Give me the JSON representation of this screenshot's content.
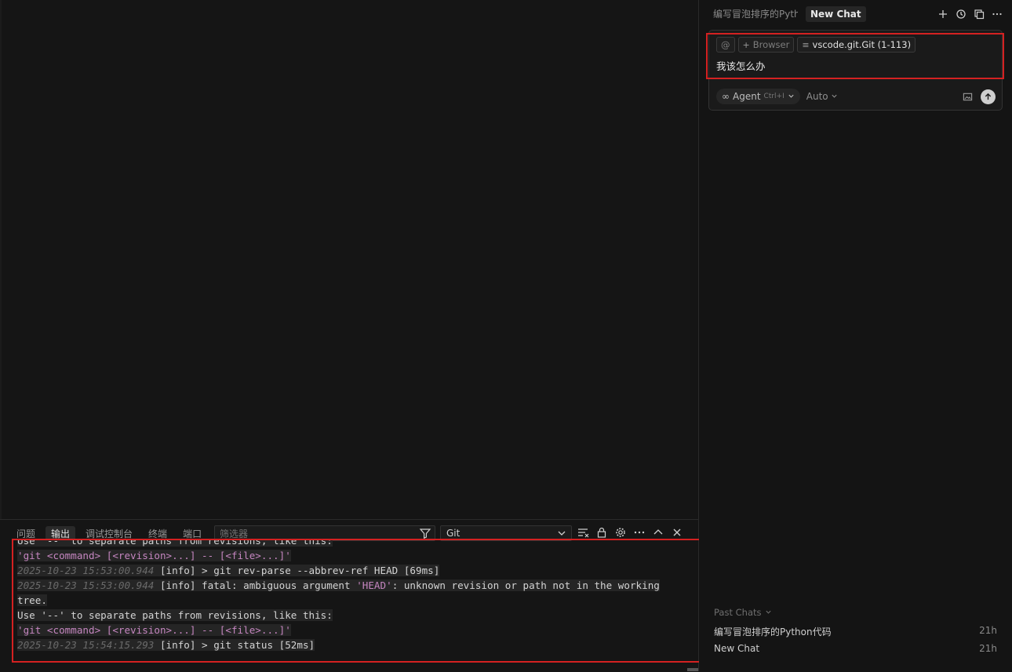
{
  "panel": {
    "tabs": [
      "问题",
      "输出",
      "调试控制台",
      "终端",
      "端口"
    ],
    "active_tab": "输出",
    "filter_placeholder": "筛选器",
    "channel": "Git",
    "output_lines": [
      [
        {
          "t": "Use '--' to separate paths from revisions, like this:",
          "c": "plain"
        }
      ],
      [
        {
          "t": "'git <command> [<revision>...] -- [<file>...]'",
          "c": "str"
        }
      ],
      [
        {
          "t": "2025-10-23 15:53:00.944",
          "c": "ts"
        },
        {
          "t": " [info] > git rev-parse --abbrev-ref HEAD [69ms]",
          "c": "plain"
        }
      ],
      [
        {
          "t": "2025-10-23 15:53:00.944",
          "c": "ts"
        },
        {
          "t": " [info] fatal: ambiguous argument ",
          "c": "plain"
        },
        {
          "t": "'HEAD'",
          "c": "str"
        },
        {
          "t": ": unknown revision or path not in the working",
          "c": "plain"
        }
      ],
      [
        {
          "t": "tree.",
          "c": "plain"
        }
      ],
      [
        {
          "t": "Use '--' to separate paths from revisions, like this:",
          "c": "plain"
        }
      ],
      [
        {
          "t": "'git <command> [<revision>...] -- [<file>...]'",
          "c": "str"
        }
      ],
      [
        {
          "t": "2025-10-23 15:54:15.293",
          "c": "ts"
        },
        {
          "t": " [info] > git status [52ms]",
          "c": "plain"
        }
      ]
    ]
  },
  "sidebar": {
    "tab_history": "编写冒泡排序的Pyth",
    "tab_active": "New Chat",
    "composer": {
      "mention_symbol": "@",
      "browser_chip": "Browser",
      "file_chip": "vscode.git.Git (1-113)",
      "prompt_text": "我该怎么办",
      "mode_label": "Agent",
      "mode_shortcut": "Ctrl+I",
      "model_label": "Auto"
    },
    "past_chats_label": "Past Chats",
    "past_chats": [
      {
        "title": "编写冒泡排序的Python代码",
        "age": "21h"
      },
      {
        "title": "New Chat",
        "age": "21h"
      }
    ]
  },
  "colors": {
    "highlight_border": "#d42121",
    "timestamp": "#6a6a6a",
    "string": "#c586c0"
  }
}
